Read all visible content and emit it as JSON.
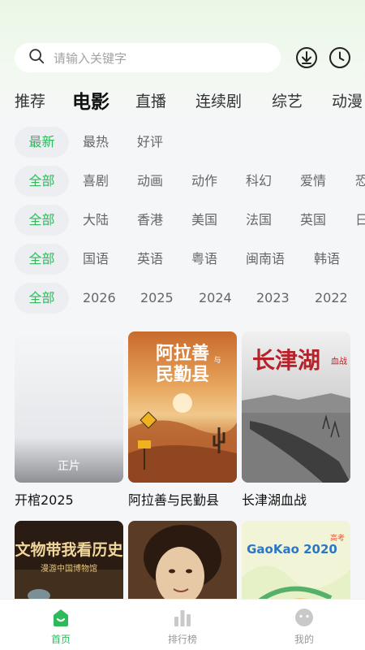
{
  "search": {
    "placeholder": "请输入关键字"
  },
  "top_icons": [
    "download-icon",
    "history-clock-icon"
  ],
  "tabs": [
    {
      "label": "推荐",
      "active": false
    },
    {
      "label": "电影",
      "active": true
    },
    {
      "label": "直播",
      "active": false
    },
    {
      "label": "连续剧",
      "active": false
    },
    {
      "label": "综艺",
      "active": false
    },
    {
      "label": "动漫",
      "active": false
    }
  ],
  "filters": {
    "sort": {
      "selected": "最新",
      "options": [
        "最热",
        "好评"
      ]
    },
    "genre": {
      "selected": "全部",
      "options": [
        "喜剧",
        "动画",
        "动作",
        "科幻",
        "爱情",
        "恐"
      ]
    },
    "region": {
      "selected": "全部",
      "options": [
        "大陆",
        "香港",
        "美国",
        "法国",
        "英国",
        "日"
      ]
    },
    "language": {
      "selected": "全部",
      "options": [
        "国语",
        "英语",
        "粤语",
        "闽南语",
        "韩语"
      ]
    },
    "year": {
      "selected": "全部",
      "options": [
        "2026",
        "2025",
        "2024",
        "2023",
        "2022"
      ]
    }
  },
  "movies": [
    {
      "title": "开棺2025",
      "badge": "正片",
      "poster_text": ""
    },
    {
      "title": "阿拉善与民勤县",
      "badge": "",
      "poster_text": "阿拉善",
      "poster_text2": "民勤县",
      "poster_small": "与"
    },
    {
      "title": "长津湖血战",
      "badge": "",
      "poster_text": "长津湖",
      "poster_small": "血战"
    },
    {
      "title": "",
      "badge": "",
      "poster_text": "文物带我看历史",
      "poster_sub": "漫游中国博物馆"
    },
    {
      "title": "",
      "badge": "",
      "poster_text": ""
    },
    {
      "title": "",
      "badge": "",
      "poster_text": "GaoKao 2020",
      "poster_small": "高考"
    }
  ],
  "bottom_nav": [
    {
      "label": "首页",
      "icon": "home-icon",
      "active": true
    },
    {
      "label": "排行榜",
      "icon": "ranking-bars-icon",
      "active": false
    },
    {
      "label": "我的",
      "icon": "profile-face-icon",
      "active": false
    }
  ],
  "colors": {
    "accent": "#2dba5a",
    "chip_bg": "#eceef1",
    "text_muted": "#666666"
  }
}
